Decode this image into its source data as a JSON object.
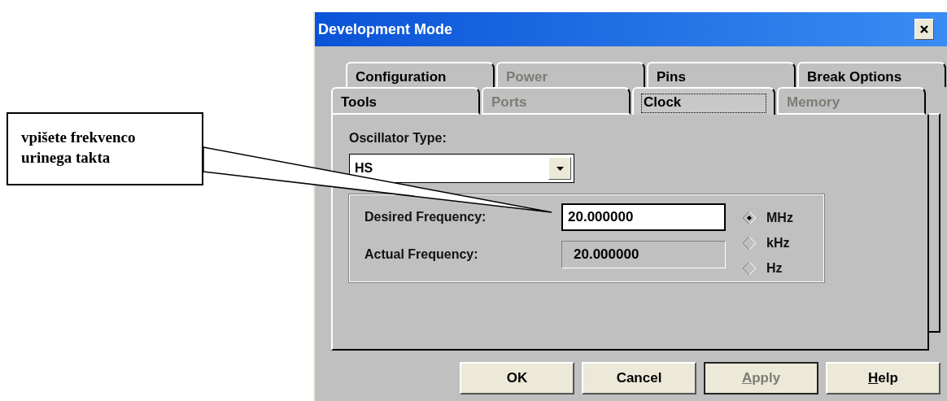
{
  "annotation": {
    "text": "vpišete frekvenco\nurinega takta"
  },
  "window": {
    "title": "Development Mode"
  },
  "tab_rows": [
    [
      {
        "label": "Configuration",
        "selected": false,
        "disabled": false
      },
      {
        "label": "Power",
        "selected": false,
        "disabled": true
      },
      {
        "label": "Pins",
        "selected": false,
        "disabled": false
      },
      {
        "label": "Break Options",
        "selected": false,
        "disabled": false
      }
    ],
    [
      {
        "label": "Tools",
        "selected": false,
        "disabled": false
      },
      {
        "label": "Ports",
        "selected": false,
        "disabled": true
      },
      {
        "label": "Clock",
        "selected": true,
        "disabled": false
      },
      {
        "label": "Memory",
        "selected": false,
        "disabled": true
      }
    ]
  ],
  "oscillator_type": {
    "label": "Oscillator Type:",
    "value": "HS"
  },
  "frequency": {
    "desired": {
      "label": "Desired Frequency:",
      "value": "20.000000"
    },
    "actual": {
      "label": "Actual Frequency:",
      "value": "20.000000"
    }
  },
  "units": [
    {
      "label": "MHz",
      "selected": true
    },
    {
      "label": "kHz",
      "selected": false
    },
    {
      "label": "Hz",
      "selected": false
    }
  ],
  "buttons": [
    {
      "label": "OK",
      "disabled": false,
      "focused": false,
      "mnemonic": false
    },
    {
      "label": "Cancel",
      "disabled": false,
      "focused": false,
      "mnemonic": false
    },
    {
      "label": "Apply",
      "disabled": true,
      "focused": true,
      "mnemonic": true
    },
    {
      "label": "Help",
      "disabled": false,
      "focused": false,
      "mnemonic": true
    }
  ]
}
